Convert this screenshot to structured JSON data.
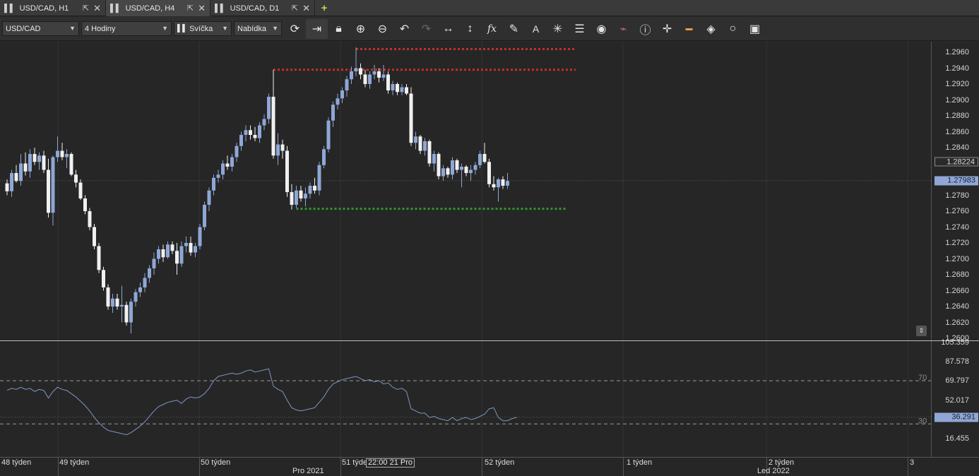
{
  "tabs": [
    {
      "label": "USD/CAD, H1",
      "active": false
    },
    {
      "label": "USD/CAD, H4",
      "active": true
    },
    {
      "label": "USD/CAD, D1",
      "active": false
    }
  ],
  "toolbar": {
    "instrument": "USD/CAD",
    "period": "4 Hodiny",
    "chart_type": "Svíčka",
    "menu": "Nabídka",
    "icons": [
      "refresh-icon",
      "shift-chart-icon",
      "lock-icon",
      "zoom-in-icon",
      "zoom-out-icon",
      "undo-icon",
      "redo-icon",
      "horizontal-stretch-icon",
      "vertical-stretch-icon",
      "indicator-fx-icon",
      "pencil-icon",
      "text-icon",
      "crosshair-icon",
      "layers-icon",
      "eye-icon",
      "alert-icon",
      "info-icon",
      "cross-cursor-icon",
      "color-theme-icon",
      "paint-bucket-icon",
      "circle-settings-icon",
      "save-icon"
    ]
  },
  "colors": {
    "bull": "#8ea7d6",
    "bear": "#f0f0f0",
    "resistance": "#c0302a",
    "support": "#2a9a2a",
    "rsi_line": "#7f95c4"
  },
  "chart_data": [
    {
      "type": "candlestick",
      "title": "USD/CAD",
      "ylim": [
        1.26,
        1.297
      ],
      "y_ticks": [
        "1.2960",
        "1.2940",
        "1.2920",
        "1.2900",
        "1.2880",
        "1.2860",
        "1.2840",
        "1.2820",
        "1.2800",
        "1.2780",
        "1.2760",
        "1.2740",
        "1.2720",
        "1.2700",
        "1.2680",
        "1.2660",
        "1.2640",
        "1.2620",
        "1.2600"
      ],
      "last_price_label": "1.27983",
      "mark_label": "1.28224",
      "resistance_levels": [
        1.2964,
        1.2938
      ],
      "support_level": 1.2763,
      "candles": [
        [
          1.2795,
          1.28,
          1.278,
          1.2785
        ],
        [
          1.2785,
          1.2812,
          1.2778,
          1.2808
        ],
        [
          1.2808,
          1.2818,
          1.2796,
          1.2798
        ],
        [
          1.2798,
          1.2832,
          1.2792,
          1.282
        ],
        [
          1.282,
          1.2834,
          1.2805,
          1.281
        ],
        [
          1.281,
          1.2838,
          1.2802,
          1.2832
        ],
        [
          1.2832,
          1.284,
          1.2818,
          1.2822
        ],
        [
          1.2822,
          1.2834,
          1.2812,
          1.283
        ],
        [
          1.283,
          1.2836,
          1.2808,
          1.2812
        ],
        [
          1.2812,
          1.2826,
          1.2752,
          1.2758
        ],
        [
          1.2758,
          1.283,
          1.2742,
          1.2828
        ],
        [
          1.2828,
          1.2854,
          1.2822,
          1.2836
        ],
        [
          1.2836,
          1.2846,
          1.2824,
          1.2828
        ],
        [
          1.2828,
          1.2838,
          1.2814,
          1.2832
        ],
        [
          1.2832,
          1.2834,
          1.2804,
          1.2806
        ],
        [
          1.2806,
          1.2812,
          1.279,
          1.2796
        ],
        [
          1.2796,
          1.28,
          1.2774,
          1.2776
        ],
        [
          1.2776,
          1.278,
          1.2756,
          1.276
        ],
        [
          1.276,
          1.2764,
          1.2736,
          1.274
        ],
        [
          1.274,
          1.2744,
          1.2712,
          1.2716
        ],
        [
          1.2716,
          1.272,
          1.2682,
          1.2686
        ],
        [
          1.2686,
          1.269,
          1.266,
          1.2664
        ],
        [
          1.2664,
          1.2668,
          1.2636,
          1.264
        ],
        [
          1.264,
          1.2656,
          1.2632,
          1.265
        ],
        [
          1.265,
          1.2656,
          1.2636,
          1.264
        ],
        [
          1.264,
          1.2666,
          1.262,
          1.2642
        ],
        [
          1.2642,
          1.2646,
          1.2616,
          1.262
        ],
        [
          1.262,
          1.265,
          1.2606,
          1.2646
        ],
        [
          1.2646,
          1.2662,
          1.264,
          1.2658
        ],
        [
          1.2658,
          1.267,
          1.2652,
          1.2664
        ],
        [
          1.2664,
          1.2682,
          1.2658,
          1.2676
        ],
        [
          1.2676,
          1.2692,
          1.267,
          1.2688
        ],
        [
          1.2688,
          1.2708,
          1.268,
          1.27
        ],
        [
          1.27,
          1.2716,
          1.2694,
          1.2712
        ],
        [
          1.2712,
          1.2718,
          1.2696,
          1.2702
        ],
        [
          1.2702,
          1.2722,
          1.27,
          1.2718
        ],
        [
          1.2718,
          1.2722,
          1.2706,
          1.271
        ],
        [
          1.271,
          1.272,
          1.268,
          1.2694
        ],
        [
          1.2694,
          1.2722,
          1.269,
          1.2716
        ],
        [
          1.2716,
          1.2728,
          1.2708,
          1.272
        ],
        [
          1.272,
          1.2728,
          1.2704,
          1.2708
        ],
        [
          1.2708,
          1.272,
          1.2702,
          1.2716
        ],
        [
          1.2716,
          1.2744,
          1.2712,
          1.274
        ],
        [
          1.274,
          1.2772,
          1.2736,
          1.2768
        ],
        [
          1.2768,
          1.279,
          1.276,
          1.2786
        ],
        [
          1.2786,
          1.2806,
          1.278,
          1.2802
        ],
        [
          1.2802,
          1.2812,
          1.2796,
          1.2806
        ],
        [
          1.2806,
          1.2824,
          1.28,
          1.282
        ],
        [
          1.282,
          1.283,
          1.2812,
          1.2816
        ],
        [
          1.2816,
          1.2832,
          1.281,
          1.2828
        ],
        [
          1.2828,
          1.2846,
          1.2822,
          1.2842
        ],
        [
          1.2842,
          1.286,
          1.2836,
          1.2856
        ],
        [
          1.2856,
          1.2868,
          1.2848,
          1.2862
        ],
        [
          1.2862,
          1.2868,
          1.285,
          1.2856
        ],
        [
          1.2856,
          1.2866,
          1.2848,
          1.2852
        ],
        [
          1.2852,
          1.2872,
          1.2846,
          1.2868
        ],
        [
          1.2868,
          1.2882,
          1.2862,
          1.2876
        ],
        [
          1.2876,
          1.2908,
          1.287,
          1.2904
        ],
        [
          1.2904,
          1.2938,
          1.2826,
          1.283
        ],
        [
          1.283,
          1.2858,
          1.2818,
          1.2844
        ],
        [
          1.2844,
          1.285,
          1.2826,
          1.2836
        ],
        [
          1.2836,
          1.2842,
          1.2778,
          1.2784
        ],
        [
          1.2784,
          1.2794,
          1.2762,
          1.2768
        ],
        [
          1.2768,
          1.2792,
          1.2764,
          1.2786
        ],
        [
          1.2786,
          1.2792,
          1.2772,
          1.2776
        ],
        [
          1.2776,
          1.279,
          1.2766,
          1.2782
        ],
        [
          1.2782,
          1.2796,
          1.2776,
          1.2792
        ],
        [
          1.2792,
          1.2802,
          1.2782,
          1.2786
        ],
        [
          1.2786,
          1.2822,
          1.278,
          1.2818
        ],
        [
          1.2818,
          1.2842,
          1.2814,
          1.2838
        ],
        [
          1.2838,
          1.2878,
          1.2834,
          1.2874
        ],
        [
          1.2874,
          1.2898,
          1.2866,
          1.2894
        ],
        [
          1.2894,
          1.2908,
          1.2888,
          1.2902
        ],
        [
          1.2902,
          1.2916,
          1.2896,
          1.2912
        ],
        [
          1.2912,
          1.293,
          1.2904,
          1.2926
        ],
        [
          1.2926,
          1.2942,
          1.292,
          1.2936
        ],
        [
          1.2936,
          1.2966,
          1.293,
          1.294
        ],
        [
          1.294,
          1.2946,
          1.2926,
          1.2932
        ],
        [
          1.2932,
          1.2938,
          1.2916,
          1.292
        ],
        [
          1.292,
          1.2936,
          1.2914,
          1.2932
        ],
        [
          1.2932,
          1.2944,
          1.2926,
          1.2936
        ],
        [
          1.2936,
          1.294,
          1.2922,
          1.2928
        ],
        [
          1.2928,
          1.2944,
          1.2924,
          1.2932
        ],
        [
          1.2932,
          1.2936,
          1.2908,
          1.2912
        ],
        [
          1.2912,
          1.2924,
          1.2906,
          1.292
        ],
        [
          1.292,
          1.2922,
          1.2906,
          1.291
        ],
        [
          1.291,
          1.292,
          1.2906,
          1.2916
        ],
        [
          1.2916,
          1.292,
          1.2906,
          1.2908
        ],
        [
          1.2908,
          1.2916,
          1.2842,
          1.2846
        ],
        [
          1.2846,
          1.286,
          1.2838,
          1.2854
        ],
        [
          1.2854,
          1.2856,
          1.2832,
          1.2836
        ],
        [
          1.2836,
          1.2852,
          1.283,
          1.2848
        ],
        [
          1.2848,
          1.285,
          1.2816,
          1.282
        ],
        [
          1.282,
          1.2836,
          1.281,
          1.2832
        ],
        [
          1.2832,
          1.2834,
          1.28,
          1.2804
        ],
        [
          1.2804,
          1.2818,
          1.2798,
          1.2814
        ],
        [
          1.2814,
          1.2816,
          1.2802,
          1.2806
        ],
        [
          1.2806,
          1.2828,
          1.28,
          1.2824
        ],
        [
          1.2824,
          1.2826,
          1.2808,
          1.2812
        ],
        [
          1.2812,
          1.282,
          1.279,
          1.2816
        ],
        [
          1.2816,
          1.2818,
          1.2804,
          1.2808
        ],
        [
          1.2808,
          1.2818,
          1.2798,
          1.2812
        ],
        [
          1.2812,
          1.2822,
          1.2806,
          1.2818
        ],
        [
          1.2818,
          1.2836,
          1.2814,
          1.2832
        ],
        [
          1.2832,
          1.2846,
          1.282,
          1.2822
        ],
        [
          1.2822,
          1.2826,
          1.279,
          1.2794
        ],
        [
          1.2794,
          1.2804,
          1.2786,
          1.279
        ],
        [
          1.279,
          1.2802,
          1.2772,
          1.28
        ],
        [
          1.28,
          1.2804,
          1.2788,
          1.2792
        ],
        [
          1.2792,
          1.2808,
          1.2788,
          1.2798
        ]
      ]
    },
    {
      "type": "line",
      "title": "RSI",
      "ylim": [
        10,
        106
      ],
      "y_ticks": [
        "105.359",
        "87.578",
        "69.797",
        "52.017",
        "16.455"
      ],
      "levels": [
        70,
        30
      ],
      "level_labels": [
        "70",
        "30"
      ],
      "last_value_label": "36.291",
      "values": [
        61,
        63,
        62,
        64,
        62,
        63,
        60,
        62,
        61,
        54,
        60,
        64,
        62,
        61,
        58,
        55,
        51,
        47,
        42,
        36,
        31,
        27,
        24,
        23,
        22,
        21,
        20,
        22,
        25,
        28,
        32,
        37,
        42,
        46,
        48,
        50,
        51,
        52,
        49,
        53,
        55,
        54,
        55,
        58,
        63,
        70,
        74,
        75,
        76,
        77,
        76,
        77,
        79,
        80,
        78,
        79,
        80,
        81,
        65,
        62,
        60,
        52,
        45,
        43,
        42,
        43,
        44,
        45,
        50,
        55,
        62,
        67,
        69,
        71,
        72,
        73,
        74,
        72,
        70,
        71,
        69,
        70,
        67,
        68,
        64,
        62,
        63,
        60,
        44,
        42,
        40,
        40,
        36,
        37,
        35,
        34,
        33,
        36,
        33,
        35,
        36,
        34,
        35,
        37,
        39,
        44,
        45,
        36,
        33,
        33,
        35,
        36
      ],
      "x_labels": [
        "48 týden",
        "49 týden",
        "50 týden",
        "51 týden",
        "52 týden",
        "1 týden",
        "2 týden",
        "3"
      ],
      "month_labels": [
        "Pro 2021",
        "Led 2022"
      ],
      "crosshair_label": "22:00 21 Pro"
    }
  ]
}
